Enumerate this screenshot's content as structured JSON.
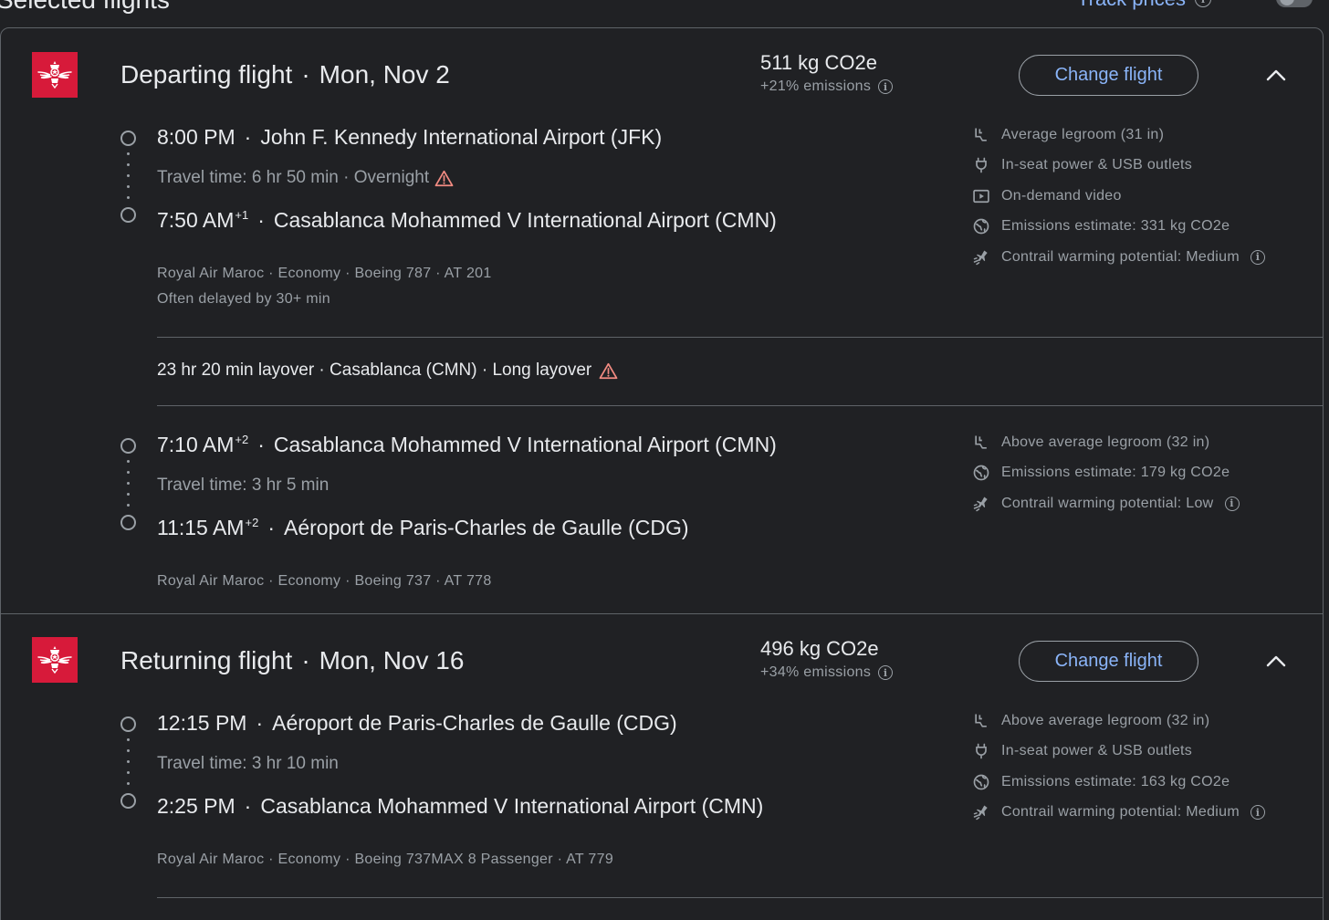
{
  "page": {
    "title": "Selected flights",
    "track_label": "Track prices"
  },
  "departing": {
    "title": "Departing flight",
    "date": "Mon, Nov 2",
    "emissions": "511 kg CO2e",
    "emissions_delta": "+21% emissions",
    "change_label": "Change flight",
    "segments": [
      {
        "dep_time": "8:00 PM",
        "dep_sup": "",
        "dep_airport": "John F. Kennedy International Airport (JFK)",
        "travel": "Travel time: 6 hr 50 min · Overnight",
        "arr_time": "7:50 AM",
        "arr_sup": "+1",
        "arr_airport": "Casablanca Mohammed V International Airport (CMN)",
        "details": "Royal Air Maroc · Economy · Boeing 787 · AT 201",
        "note": "Often delayed by 30+ min",
        "amenities": [
          {
            "icon": "legroom-icon",
            "text": "Average legroom (31 in)"
          },
          {
            "icon": "power-icon",
            "text": "In-seat power & USB outlets"
          },
          {
            "icon": "video-icon",
            "text": "On-demand video"
          },
          {
            "icon": "globe-icon",
            "text": "Emissions estimate: 331 kg CO2e"
          },
          {
            "icon": "contrail-icon",
            "text": "Contrail warming potential: Medium"
          }
        ]
      },
      {
        "dep_time": "7:10 AM",
        "dep_sup": "+2",
        "dep_airport": "Casablanca Mohammed V International Airport (CMN)",
        "travel": "Travel time: 3 hr 5 min",
        "arr_time": "11:15 AM",
        "arr_sup": "+2",
        "arr_airport": "Aéroport de Paris-Charles de Gaulle (CDG)",
        "details": "Royal Air Maroc · Economy · Boeing 737 · AT 778",
        "amenities": [
          {
            "icon": "legroom-icon",
            "text": "Above average legroom (32 in)"
          },
          {
            "icon": "globe-icon",
            "text": "Emissions estimate: 179 kg CO2e"
          },
          {
            "icon": "contrail-icon",
            "text": "Contrail warming potential: Low"
          }
        ]
      }
    ],
    "layover": "23 hr 20 min layover · Casablanca (CMN) · Long layover"
  },
  "returning": {
    "title": "Returning flight",
    "date": "Mon, Nov 16",
    "emissions": "496 kg CO2e",
    "emissions_delta": "+34% emissions",
    "change_label": "Change flight",
    "segments": [
      {
        "dep_time": "12:15 PM",
        "dep_airport": "Aéroport de Paris-Charles de Gaulle (CDG)",
        "travel": "Travel time: 3 hr 10 min",
        "arr_time": "2:25 PM",
        "arr_airport": "Casablanca Mohammed V International Airport (CMN)",
        "details": "Royal Air Maroc · Economy · Boeing 737MAX 8 Passenger · AT 779",
        "amenities": [
          {
            "icon": "legroom-icon",
            "text": "Above average legroom (32 in)"
          },
          {
            "icon": "power-icon",
            "text": "In-seat power & USB outlets"
          },
          {
            "icon": "globe-icon",
            "text": "Emissions estimate: 163 kg CO2e"
          },
          {
            "icon": "contrail-icon",
            "text": "Contrail warming potential: Medium"
          }
        ]
      }
    ]
  },
  "colors": {
    "background": "#202124",
    "accent": "#8ab4f8",
    "warning": "#f28b82",
    "logo": "#d71a3a"
  }
}
